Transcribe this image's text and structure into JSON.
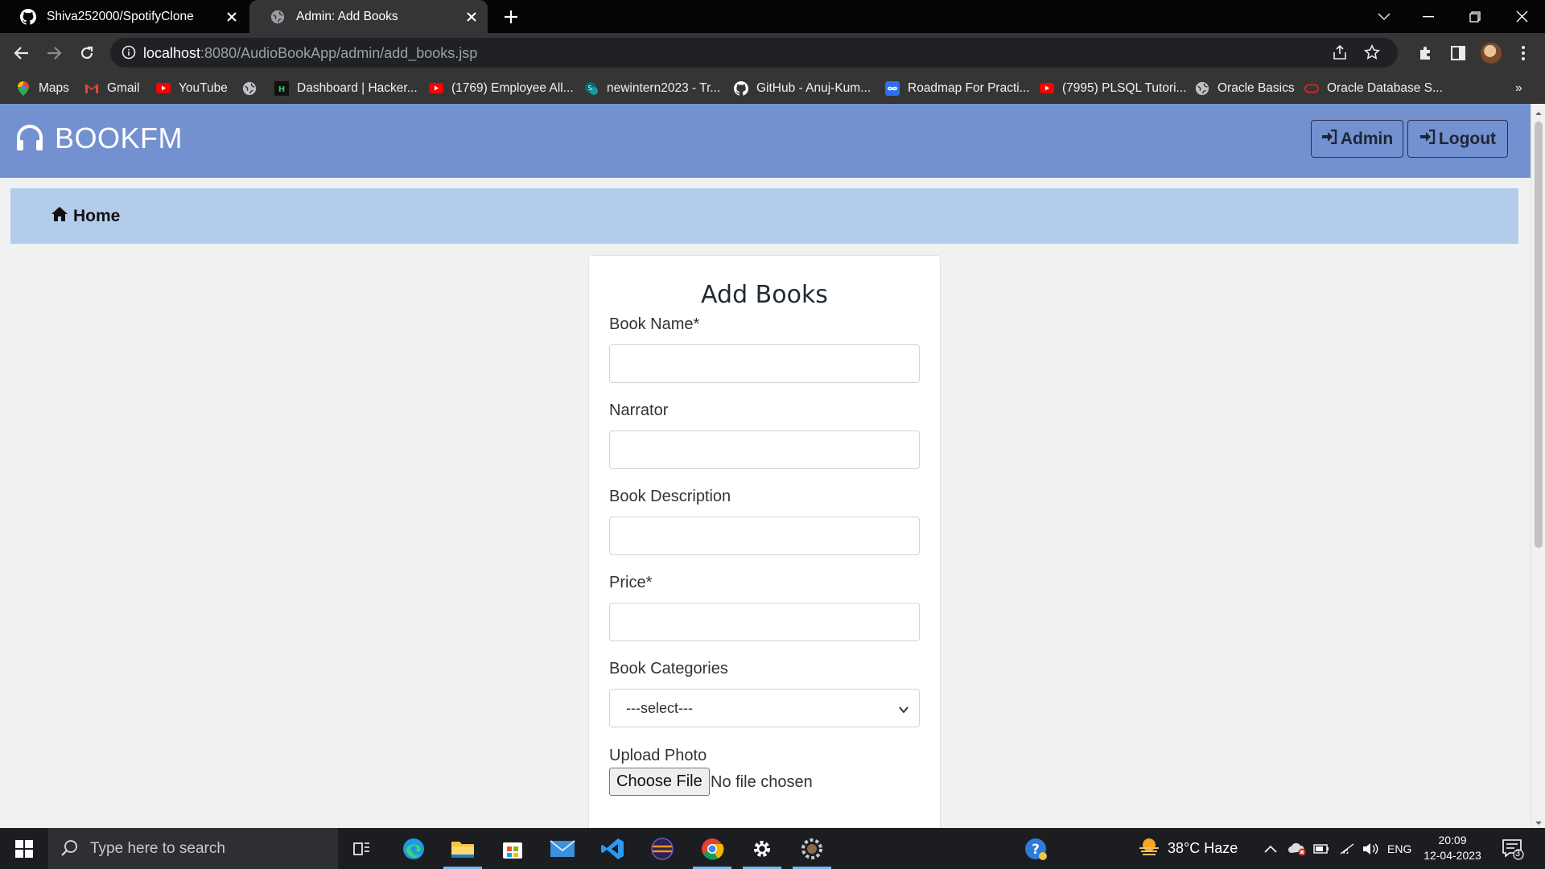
{
  "browser": {
    "tabs": [
      {
        "title": "Shiva252000/SpotifyClone",
        "icon": "github-icon"
      },
      {
        "title": "Admin: Add Books",
        "icon": "globe-icon"
      }
    ],
    "url_host": "localhost",
    "url_rest": ":8080/AudioBookApp/admin/add_books.jsp",
    "bookmarks": [
      {
        "label": "Maps",
        "icon": "maps-pin-icon"
      },
      {
        "label": "Gmail",
        "icon": "gmail-icon"
      },
      {
        "label": "YouTube",
        "icon": "youtube-icon"
      },
      {
        "label": "",
        "icon": "globe-icon"
      },
      {
        "label": "Dashboard | Hacker...",
        "icon": "hackerrank-icon"
      },
      {
        "label": "(1769) Employee All...",
        "icon": "youtube-icon"
      },
      {
        "label": "newintern2023 - Tr...",
        "icon": "sharepoint-icon"
      },
      {
        "label": "GitHub - Anuj-Kum...",
        "icon": "github-icon"
      },
      {
        "label": "Roadmap For Practi...",
        "icon": "infinity-icon"
      },
      {
        "label": "(7995) PLSQL Tutori...",
        "icon": "youtube-icon"
      },
      {
        "label": "Oracle Basics",
        "icon": "globe-icon"
      },
      {
        "label": "Oracle Database S...",
        "icon": "oracle-icon"
      }
    ],
    "bookmarks_more": "»"
  },
  "page": {
    "brand": "BOOKFM",
    "admin_label": "Admin",
    "logout_label": "Logout",
    "home_label": "Home",
    "form": {
      "title": "Add Books",
      "book_name_label": "Book Name*",
      "narrator_label": "Narrator",
      "description_label": "Book Description",
      "price_label": "Price*",
      "categories_label": "Book Categories",
      "categories_selected": "---select---",
      "upload_photo_label": "Upload Photo",
      "choose_file_label": "Choose File",
      "no_file_text": "No file chosen"
    }
  },
  "taskbar": {
    "search_placeholder": "Type here to search",
    "weather": "38°C  Haze",
    "language": "ENG",
    "time": "20:09",
    "date": "12-04-2023",
    "notification_count": "3"
  }
}
